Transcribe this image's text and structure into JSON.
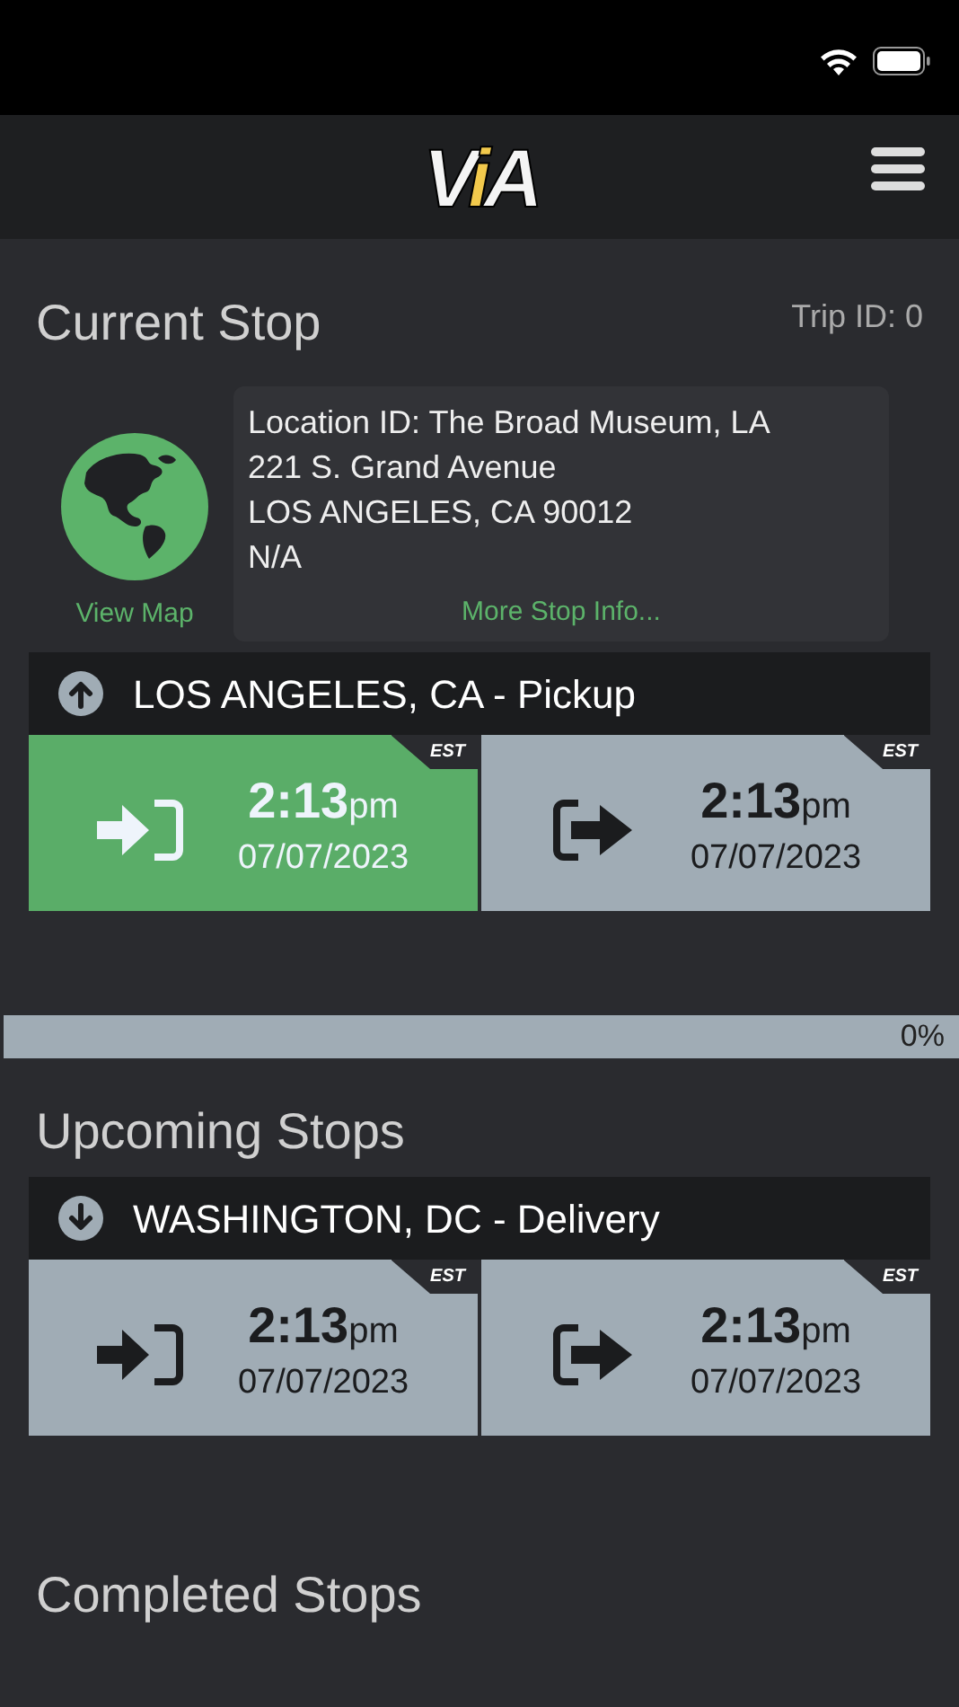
{
  "logo": {
    "text": "ViA"
  },
  "current_stop": {
    "title": "Current Stop",
    "trip_id": "Trip ID: 0",
    "view_map": "View Map",
    "info_lines": [
      "Location ID: The Broad Museum, LA",
      "221 S. Grand Avenue",
      "LOS ANGELES, CA 90012",
      "N/A"
    ],
    "more_info": "More Stop Info...",
    "stop": {
      "kind": "up",
      "title": "LOS ANGELES, CA - Pickup",
      "cells": [
        {
          "kind": "arrive",
          "done": true,
          "time": "2:13",
          "ampm": "pm",
          "date": "07/07/2023",
          "tz": "EST"
        },
        {
          "kind": "depart",
          "done": false,
          "time": "2:13",
          "ampm": "pm",
          "date": "07/07/2023",
          "tz": "EST"
        }
      ]
    }
  },
  "progress": {
    "level": 0,
    "reading": "0%"
  },
  "upcoming_stops": {
    "title": "Upcoming Stops",
    "stops": [
      {
        "kind": "down",
        "title": "WASHINGTON, DC - Delivery",
        "cells": [
          {
            "kind": "arrive",
            "done": false,
            "time": "2:13",
            "ampm": "pm",
            "date": "07/07/2023",
            "tz": "EST"
          },
          {
            "kind": "depart",
            "done": false,
            "time": "2:13",
            "ampm": "pm",
            "date": "07/07/2023",
            "tz": "EST"
          }
        ]
      }
    ]
  },
  "completed_stops": {
    "title": "Completed Stops"
  }
}
